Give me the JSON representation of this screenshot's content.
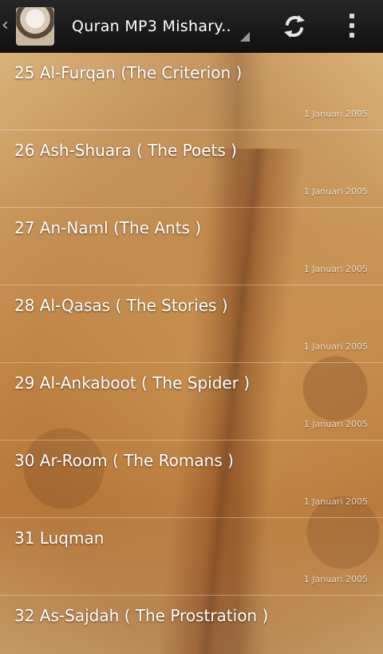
{
  "actionbar": {
    "title": "Quran MP3 Mishary..",
    "icons": {
      "up": "chevron-left-icon",
      "app": "app-avatar-icon",
      "refresh": "refresh-icon",
      "overflow": "overflow-menu-icon"
    }
  },
  "list": {
    "items": [
      {
        "title": "25 Al-Furqan (The Criterion )",
        "date": "1 Januari 2005"
      },
      {
        "title": "26 Ash-Shuara ( The Poets )",
        "date": "1 Januari 2005"
      },
      {
        "title": "27 An-Naml (The Ants )",
        "date": "1 Januari 2005"
      },
      {
        "title": "28 Al-Qasas ( The Stories )",
        "date": "1 Januari 2005"
      },
      {
        "title": "29 Al-Ankaboot ( The Spider )",
        "date": "1 Januari 2005"
      },
      {
        "title": "30 Ar-Room ( The Romans )",
        "date": "1 Januari 2005"
      },
      {
        "title": "31 Luqman",
        "date": "1 Januari 2005"
      },
      {
        "title": "32 As-Sajdah ( The Prostration )",
        "date": ""
      }
    ]
  },
  "colors": {
    "actionbar_bg": "#1a1a1a",
    "text": "#ffffff",
    "divider": "#e8d2b0"
  }
}
